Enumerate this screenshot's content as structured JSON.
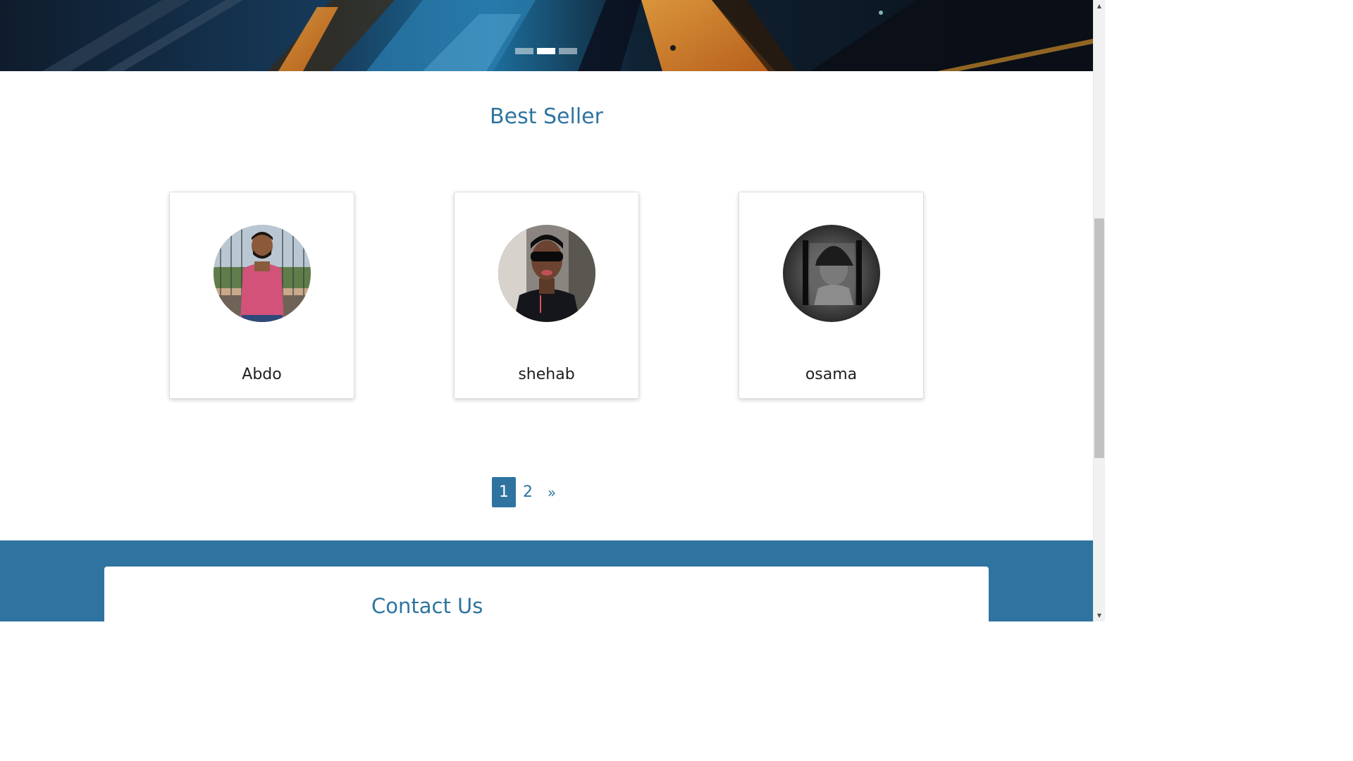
{
  "hero": {
    "carousel": {
      "slide_count": 3,
      "active_index": 1
    }
  },
  "best_seller": {
    "title": "Best Seller",
    "sellers": [
      {
        "name": "Abdo",
        "avatar": "profile-photo"
      },
      {
        "name": "shehab",
        "avatar": "profile-photo"
      },
      {
        "name": "osama",
        "avatar": "profile-photo"
      }
    ]
  },
  "pagination": {
    "pages": [
      "1",
      "2"
    ],
    "current_page": "1",
    "next_label": "»"
  },
  "contact": {
    "title": "Contact Us"
  },
  "scrollbar": {
    "up_icon": "arrow-up-icon",
    "down_icon": "arrow-down-icon"
  },
  "colors": {
    "accent": "#2f74a0",
    "card_name": "#1f1f1f",
    "background": "#ffffff"
  }
}
